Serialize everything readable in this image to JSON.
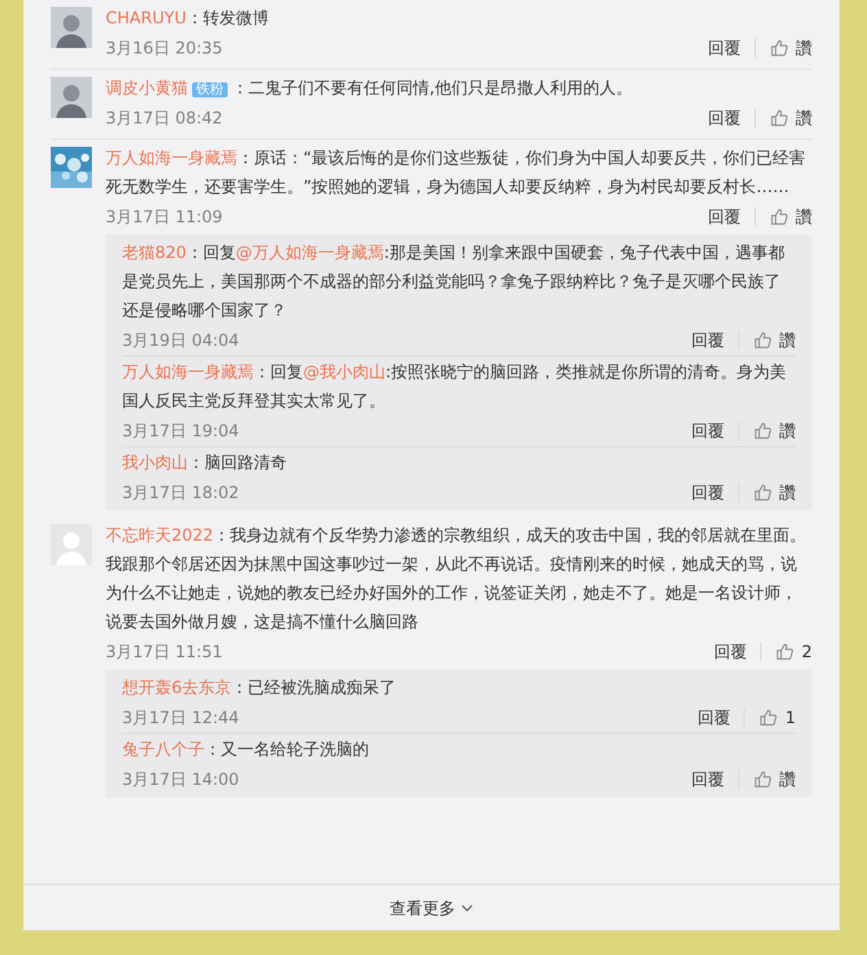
{
  "comments": [
    {
      "user": "CHARUYU",
      "avatar": {
        "kind": "person"
      },
      "text": "：转发微博",
      "time": "3月16日 20:35",
      "reply_label": "回覆",
      "like": "讚"
    },
    {
      "user": "调皮小黄猫",
      "badge": "铁粉",
      "avatar": {
        "kind": "person"
      },
      "text": "：二鬼子们不要有任何同情,他们只是昂撒人利用的人。",
      "time": "3月17日 08:42",
      "reply_label": "回覆",
      "like": "讚"
    },
    {
      "user": "万人如海一身藏焉",
      "avatar": {
        "kind": "picture"
      },
      "text": "：原话：“最该后悔的是你们这些叛徒，你们身为中国人却要反共，你们已经害死无数学生，还要害学生。”按照她的逻辑，身为德国人却要反纳粹，身为村民却要反村长……",
      "time": "3月17日 11:09",
      "reply_label": "回覆",
      "like": "讚",
      "replies": [
        {
          "user": "老猫820",
          "prefix": "：回复",
          "mention": "@万人如海一身藏焉",
          "text": ":那是美国！别拿来跟中国硬套，兔子代表中国，遇事都是党员先上，美国那两个不成器的部分利益党能吗？拿兔子跟纳粹比？兔子是灭哪个民族了还是侵略哪个国家了？",
          "time": "3月19日 04:04",
          "reply_label": "回覆",
          "like": "讚"
        },
        {
          "user": "万人如海一身藏焉",
          "prefix": "：回复",
          "mention": "@我小肉山",
          "text": ":按照张晓宁的脑回路，类推就是你所谓的清奇。身为美国人反民主党反拜登其实太常见了。",
          "time": "3月17日 19:04",
          "reply_label": "回覆",
          "like": "讚"
        },
        {
          "user": "我小肉山",
          "text": "：脑回路清奇",
          "time": "3月17日 18:02",
          "reply_label": "回覆",
          "like": "讚"
        }
      ]
    },
    {
      "user": "不忘昨天2022",
      "avatar": {
        "kind": "default"
      },
      "text": "：我身边就有个反华势力渗透的宗教组织，成天的攻击中国，我的邻居就在里面。我跟那个邻居还因为抹黑中国这事吵过一架，从此不再说话。疫情刚来的时候，她成天的骂，说为什么不让她走，说她的教友已经办好国外的工作，说签证关闭，她走不了。她是一名设计师，说要去国外做月嫂，这是搞不懂什么脑回路",
      "time": "3月17日 11:51",
      "reply_label": "回覆",
      "like": "2",
      "replies": [
        {
          "user": "想开轰6去东京",
          "text": "：已经被洗脑成痴呆了",
          "time": "3月17日 12:44",
          "reply_label": "回覆",
          "like": "1"
        },
        {
          "user": "兔子八个子",
          "text": "：又一名给轮子洗脑的",
          "time": "3月17日 14:00",
          "reply_label": "回覆",
          "like": "讚"
        }
      ]
    }
  ],
  "more": "查看更多"
}
